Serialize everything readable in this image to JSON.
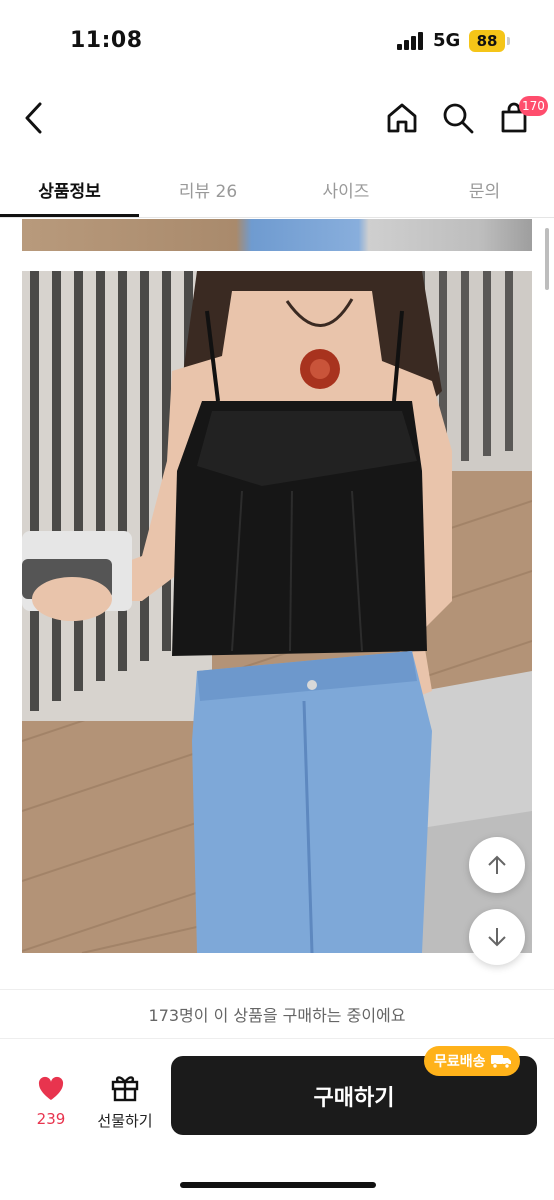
{
  "status": {
    "time": "11:08",
    "network": "5G",
    "battery": "88"
  },
  "header": {
    "cart_count": "170"
  },
  "tabs": [
    {
      "label": "상품정보",
      "active": true
    },
    {
      "label": "리뷰 26",
      "active": false
    },
    {
      "label": "사이즈",
      "active": false
    },
    {
      "label": "문의",
      "active": false
    }
  ],
  "purchase_banner": "173명이 이 상품을 구매하는 중이에요",
  "bottom": {
    "like_count": "239",
    "gift_label": "선물하기",
    "buy_label": "구매하기",
    "shipping_badge": "무료배송"
  },
  "colors": {
    "like": "#e8344e",
    "badge": "#ff4d6d",
    "shipping": "#ffb21a",
    "buy_button": "#1b1b1b"
  },
  "icons": [
    "back-icon",
    "home-icon",
    "search-icon",
    "cart-icon",
    "arrow-up-icon",
    "arrow-down-icon",
    "heart-icon",
    "gift-icon",
    "truck-icon"
  ]
}
